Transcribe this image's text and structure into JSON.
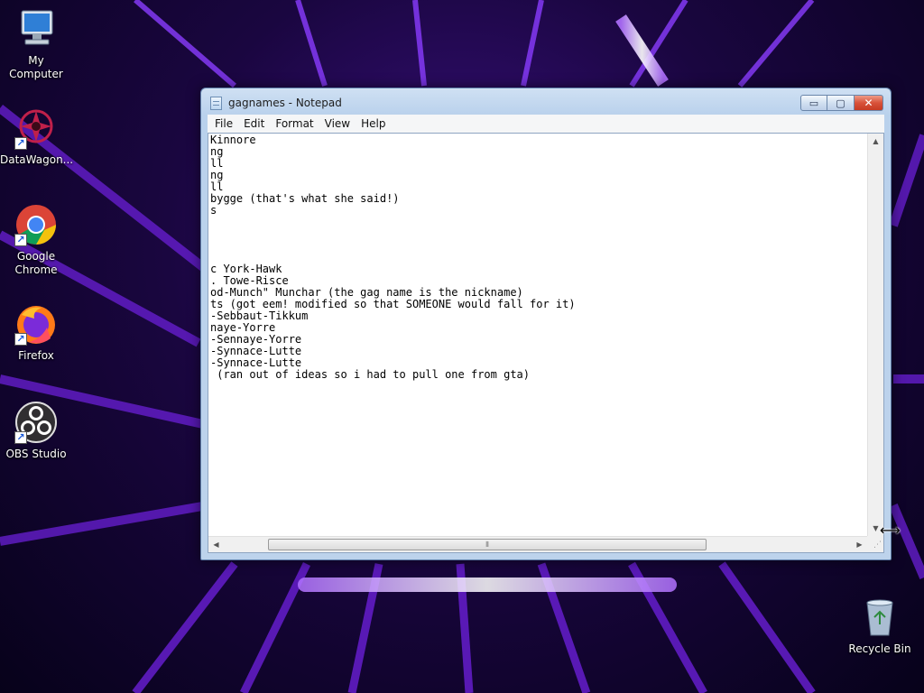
{
  "desktop": {
    "icons": [
      {
        "label": "My Computer",
        "icon": "computer-icon"
      },
      {
        "label": "DataWagon...",
        "icon": "datawagon-icon"
      },
      {
        "label": "Google Chrome",
        "icon": "chrome-icon"
      },
      {
        "label": "Firefox",
        "icon": "firefox-icon"
      },
      {
        "label": "OBS Studio",
        "icon": "obs-icon"
      },
      {
        "label": "Recycle Bin",
        "icon": "recycle-bin-icon"
      }
    ]
  },
  "notepad": {
    "title": "gagnames - Notepad",
    "menu": [
      "File",
      "Edit",
      "Format",
      "View",
      "Help"
    ],
    "lines": [
      "Kinnore",
      "ng",
      "ll",
      "ng",
      "ll",
      "bygge (that's what she said!)",
      "s",
      "",
      "",
      "",
      "",
      "c York-Hawk",
      ". Towe-Risce",
      "od-Munch\" Munchar (the gag name is the nickname)",
      "ts (got eem! modified so that SOMEONE would fall for it)",
      "-Sebbaut-Tikkum",
      "naye-Yorre",
      "-Sennaye-Yorre",
      "-Synnace-Lutte",
      "-Synnace-Lutte",
      " (ran out of ideas so i had to pull one from gta)"
    ],
    "caption_buttons": {
      "minimize": "▭",
      "maximize": "▢",
      "close": "✕"
    },
    "scrollbar_thumb_grip": "⦀"
  },
  "colors": {
    "wallpaper_accent": "#7a2cff",
    "window_frame": "#bdd3ec",
    "close_button": "#d8523a"
  }
}
